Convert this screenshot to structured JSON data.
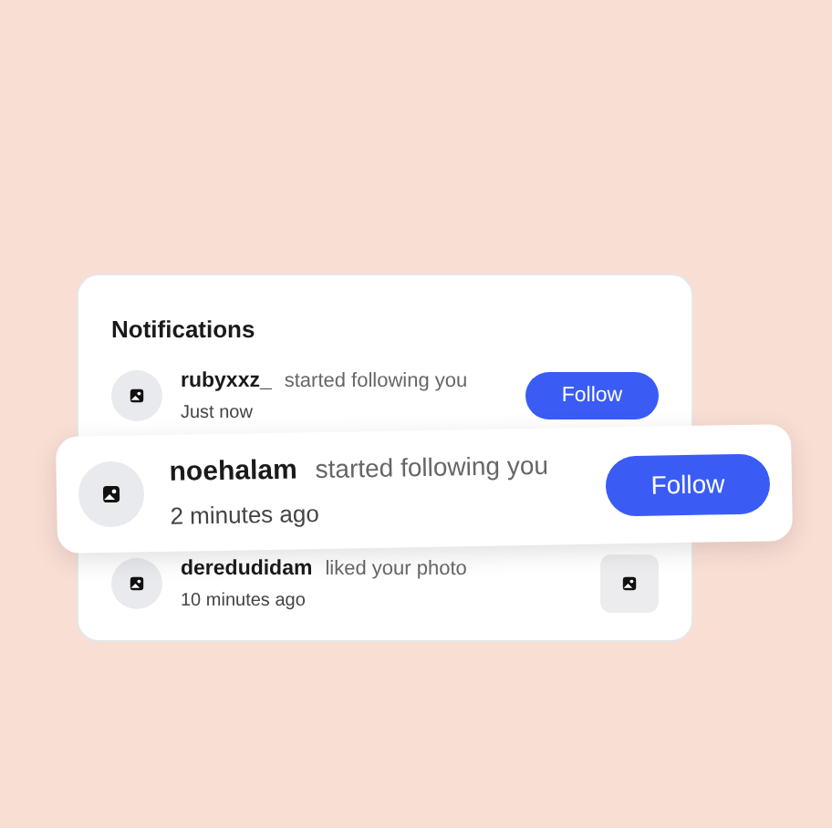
{
  "panel": {
    "title": "Notifications",
    "items": [
      {
        "kind": "follow",
        "raised": false,
        "user": "rubyxxz_",
        "action": "started following you",
        "time": "Just now",
        "button": "Follow"
      },
      {
        "kind": "follow",
        "raised": true,
        "user": "noehalam",
        "action": "started following you",
        "time": "2 minutes ago",
        "button": "Follow"
      },
      {
        "kind": "photo",
        "raised": false,
        "user": "deredudidam",
        "action": "liked your photo",
        "time": "10 minutes ago"
      }
    ]
  }
}
